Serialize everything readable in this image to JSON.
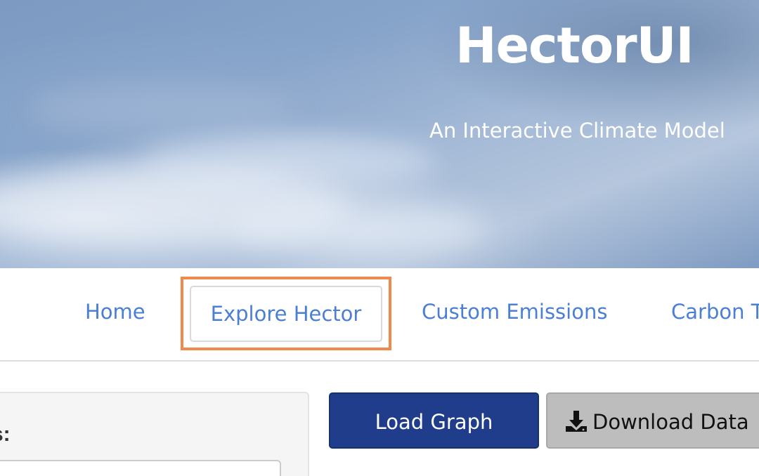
{
  "hero": {
    "title": "HectorUI",
    "subtitle": "An Interactive Climate Model"
  },
  "nav": {
    "tabs": [
      {
        "label": "Home",
        "active": false
      },
      {
        "label": "Explore Hector",
        "active": true
      },
      {
        "label": "Custom Emissions",
        "active": false
      },
      {
        "label": "Carbon T",
        "active": false
      }
    ]
  },
  "sidebar": {
    "label": "s:"
  },
  "toolbar": {
    "load_label": "Load Graph",
    "download_label": "Download Data",
    "download_icon": "download-icon"
  },
  "colors": {
    "tab_link": "#4a7fd4",
    "primary_button": "#1f3d8b",
    "secondary_button": "#bdbdbd",
    "highlight": "#ef8a4c"
  }
}
